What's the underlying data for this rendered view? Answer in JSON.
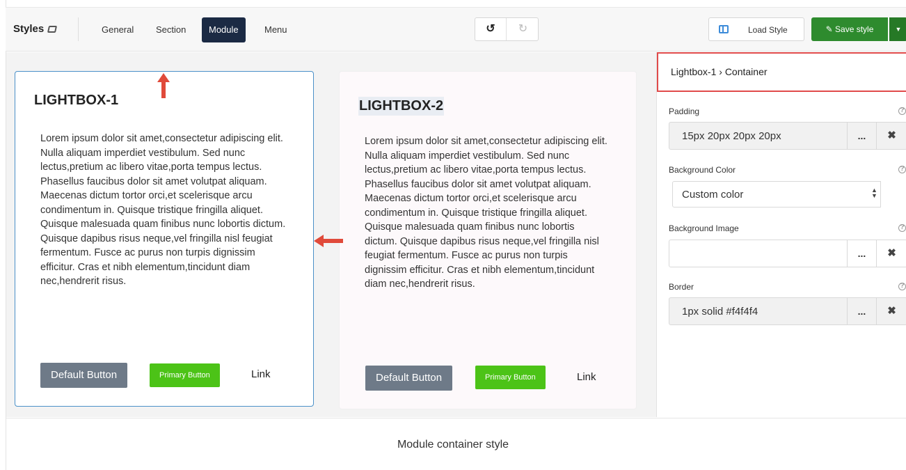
{
  "toolbar": {
    "brand": "Styles",
    "tabs": [
      "General",
      "Section",
      "Module",
      "Menu"
    ],
    "active_tab": "Module",
    "undo_icon": "↺",
    "redo_icon": "↻",
    "load_style": "Load Style",
    "save_style": "Save style",
    "save_icon": "✎",
    "caret": "▼"
  },
  "lightboxes": [
    {
      "title": "LIGHTBOX-1",
      "text": "Lorem ipsum dolor sit amet,consectetur adipiscing elit. Nulla aliquam imperdiet vestibulum. Sed nunc lectus,pretium ac libero vitae,porta tempus lectus. Phasellus faucibus dolor sit amet volutpat aliquam. Maecenas dictum tortor orci,et scelerisque arcu condimentum in. Quisque tristique fringilla aliquet. Quisque malesuada quam finibus nunc lobortis dictum. Quisque dapibus risus neque,vel fringilla nisl feugiat fermentum. Fusce ac purus non turpis dignissim efficitur. Cras et nibh elementum,tincidunt diam nec,hendrerit risus.",
      "default_button": "Default Button",
      "primary_button": "Primary Button",
      "link": "Link"
    },
    {
      "title": "LIGHTBOX-2",
      "text": "Lorem ipsum dolor sit amet,consectetur adipiscing elit. Nulla aliquam imperdiet vestibulum. Sed nunc lectus,pretium ac libero vitae,porta tempus lectus. Phasellus faucibus dolor sit amet volutpat aliquam. Maecenas dictum tortor orci,et scelerisque arcu condimentum in. Quisque tristique fringilla aliquet. Quisque malesuada quam finibus nunc lobortis dictum. Quisque dapibus risus neque,vel fringilla nisl feugiat fermentum. Fusce ac purus non turpis dignissim efficitur. Cras et nibh elementum,tincidunt diam nec,hendrerit risus.",
      "default_button": "Default Button",
      "primary_button": "Primary Button",
      "link": "Link"
    }
  ],
  "panel": {
    "breadcrumb": "Lightbox-1 › Container",
    "padding": {
      "label": "Padding",
      "value": "15px 20px 20px 20px"
    },
    "background_color": {
      "label": "Background Color",
      "value": "Custom color"
    },
    "background_image": {
      "label": "Background Image",
      "value": ""
    },
    "border": {
      "label": "Border",
      "value": "1px solid #f4f4f4"
    },
    "ellipsis": "...",
    "clear": "✖",
    "help": "?"
  },
  "caption": "Module container style",
  "colors": {
    "toolbar_active": "#1b2a44",
    "save_green": "#2e8b2e",
    "primary_button": "#4cc317",
    "default_button": "#6e7a88",
    "highlight_red": "#e04a4a",
    "selection_blue": "#4a90c8"
  }
}
